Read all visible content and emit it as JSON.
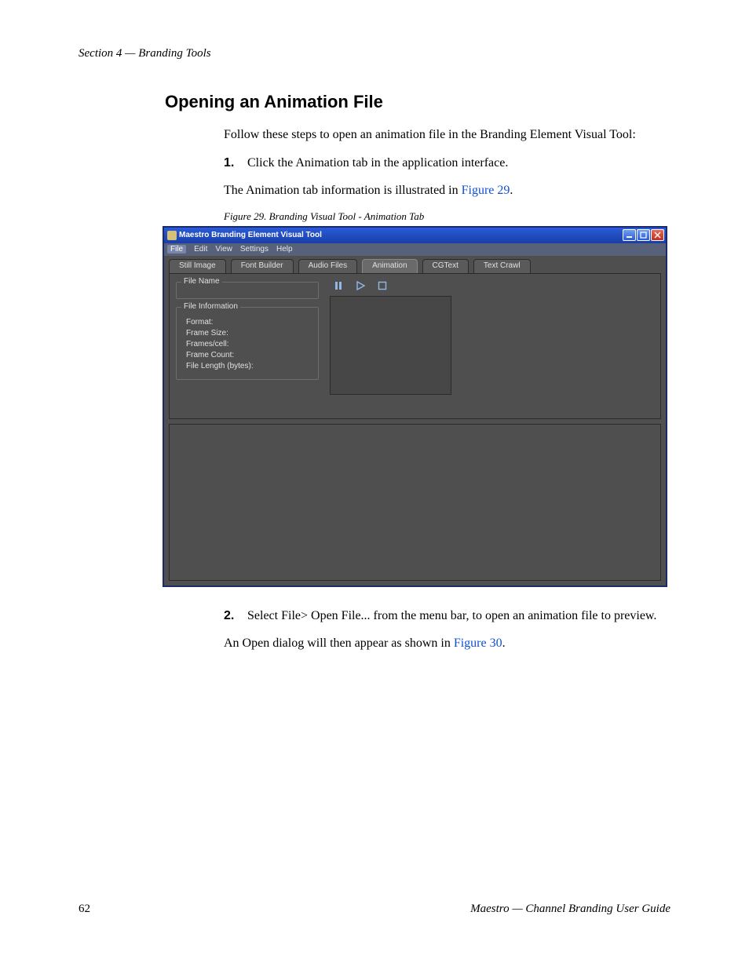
{
  "section_header": "Section 4 — Branding Tools",
  "heading": "Opening an Animation File",
  "intro": "Follow these steps to open an animation file in the Branding Element Visual Tool:",
  "step1_num": "1.",
  "step1_text": "Click the Animation tab in the application interface.",
  "illus_pre": "The Animation tab information is illustrated in ",
  "illus_link": "Figure 29",
  "illus_post": ".",
  "fig_caption": "Figure 29.  Branding Visual Tool - Animation Tab",
  "app": {
    "title": "Maestro Branding Element Visual Tool",
    "menu": {
      "file": "File",
      "edit": "Edit",
      "view": "View",
      "settings": "Settings",
      "help": "Help"
    },
    "tabs": {
      "still": "Still Image",
      "font": "Font Builder",
      "audio": "Audio Files",
      "anim": "Animation",
      "cg": "CGText",
      "crawl": "Text Crawl"
    },
    "group_filename": "File Name",
    "group_fileinfo": "File Information",
    "info": {
      "format": "Format:",
      "framesize": "Frame Size:",
      "framespercell": "Frames/cell:",
      "framecount": "Frame Count:",
      "filelength": "File Length (bytes):"
    }
  },
  "step2_num": "2.",
  "step2_text": "Select File> Open File... from the menu bar, to open an animation file to preview.",
  "outro_pre": "An Open dialog will then appear as shown in ",
  "outro_link": "Figure 30",
  "outro_post": ".",
  "footer_page": "62",
  "footer_doc": "Maestro — Channel Branding User Guide"
}
